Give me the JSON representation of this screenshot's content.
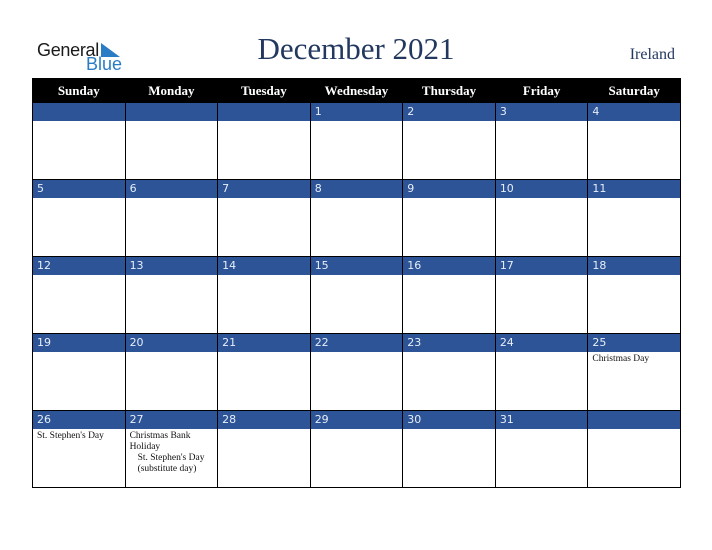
{
  "logo": {
    "line1": "General",
    "line2": "Blue"
  },
  "title": "December 2021",
  "country": "Ireland",
  "colors": {
    "header_bg": "#000000",
    "band_bg": "#2d5496",
    "title": "#23385f",
    "logo_blue": "#2a7dc4"
  },
  "weekdays": [
    "Sunday",
    "Monday",
    "Tuesday",
    "Wednesday",
    "Thursday",
    "Friday",
    "Saturday"
  ],
  "weeks": [
    {
      "days": [
        "",
        "",
        "",
        "1",
        "2",
        "3",
        "4"
      ],
      "holidays": [
        "",
        "",
        "",
        "",
        "",
        "",
        ""
      ]
    },
    {
      "days": [
        "5",
        "6",
        "7",
        "8",
        "9",
        "10",
        "11"
      ],
      "holidays": [
        "",
        "",
        "",
        "",
        "",
        "",
        ""
      ]
    },
    {
      "days": [
        "12",
        "13",
        "14",
        "15",
        "16",
        "17",
        "18"
      ],
      "holidays": [
        "",
        "",
        "",
        "",
        "",
        "",
        ""
      ]
    },
    {
      "days": [
        "19",
        "20",
        "21",
        "22",
        "23",
        "24",
        "25"
      ],
      "holidays": [
        "",
        "",
        "",
        "",
        "",
        "",
        "Christmas Day"
      ]
    },
    {
      "days": [
        "26",
        "27",
        "28",
        "29",
        "30",
        "31",
        ""
      ],
      "holidays": [
        "St. Stephen's Day",
        "Christmas Bank Holiday",
        "",
        "",
        "",
        "",
        ""
      ],
      "extra": {
        "1": "St. Stephen's Day (substitute day)"
      }
    }
  ]
}
